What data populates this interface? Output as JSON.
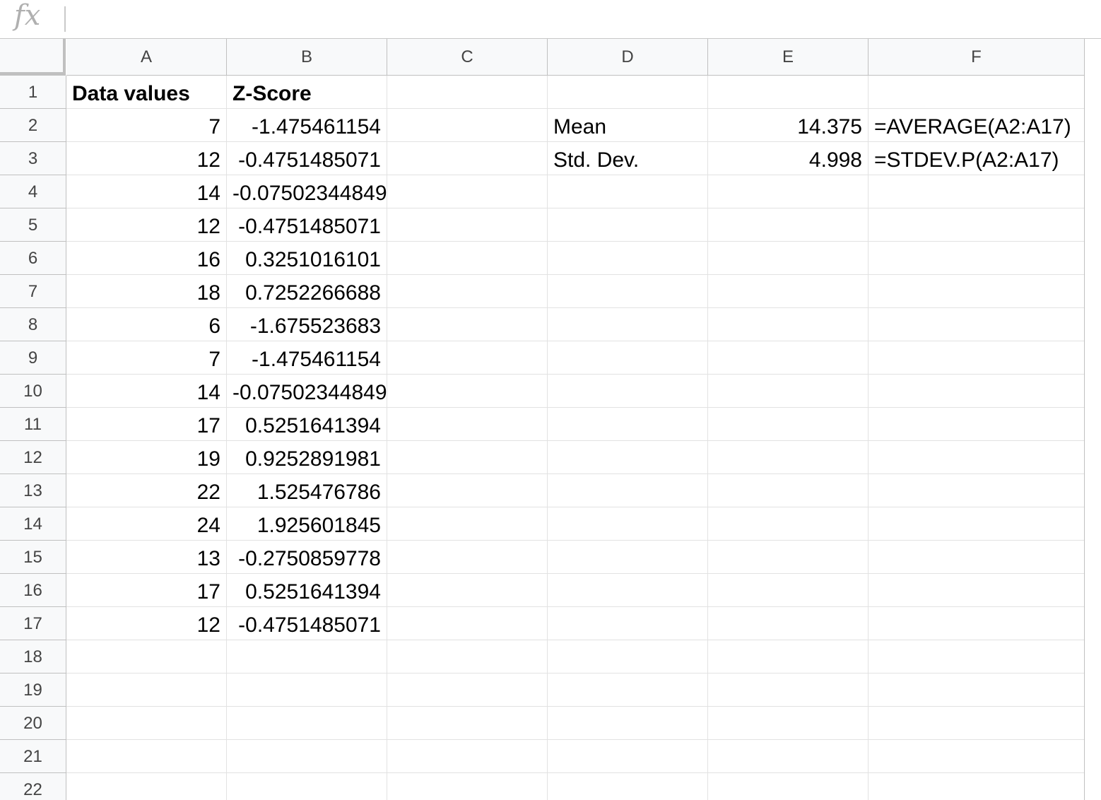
{
  "formula_bar": {
    "icon": "fx-icon",
    "value": ""
  },
  "columns": [
    "A",
    "B",
    "C",
    "D",
    "E",
    "F"
  ],
  "rows": [
    {
      "num": "1",
      "cells": [
        "Data values",
        "Z-Score",
        "",
        "",
        "",
        ""
      ]
    },
    {
      "num": "2",
      "cells": [
        "7",
        "-1.475461154",
        "",
        "Mean",
        "14.375",
        "=AVERAGE(A2:A17)"
      ]
    },
    {
      "num": "3",
      "cells": [
        "12",
        "-0.4751485071",
        "",
        "Std. Dev.",
        "4.998",
        "=STDEV.P(A2:A17)"
      ]
    },
    {
      "num": "4",
      "cells": [
        "14",
        "-0.07502344849",
        "",
        "",
        "",
        ""
      ]
    },
    {
      "num": "5",
      "cells": [
        "12",
        "-0.4751485071",
        "",
        "",
        "",
        ""
      ]
    },
    {
      "num": "6",
      "cells": [
        "16",
        "0.3251016101",
        "",
        "",
        "",
        ""
      ]
    },
    {
      "num": "7",
      "cells": [
        "18",
        "0.7252266688",
        "",
        "",
        "",
        ""
      ]
    },
    {
      "num": "8",
      "cells": [
        "6",
        "-1.675523683",
        "",
        "",
        "",
        ""
      ]
    },
    {
      "num": "9",
      "cells": [
        "7",
        "-1.475461154",
        "",
        "",
        "",
        ""
      ]
    },
    {
      "num": "10",
      "cells": [
        "14",
        "-0.07502344849",
        "",
        "",
        "",
        ""
      ]
    },
    {
      "num": "11",
      "cells": [
        "17",
        "0.5251641394",
        "",
        "",
        "",
        ""
      ]
    },
    {
      "num": "12",
      "cells": [
        "19",
        "0.9252891981",
        "",
        "",
        "",
        ""
      ]
    },
    {
      "num": "13",
      "cells": [
        "22",
        "1.525476786",
        "",
        "",
        "",
        ""
      ]
    },
    {
      "num": "14",
      "cells": [
        "24",
        "1.925601845",
        "",
        "",
        "",
        ""
      ]
    },
    {
      "num": "15",
      "cells": [
        "13",
        "-0.2750859778",
        "",
        "",
        "",
        ""
      ]
    },
    {
      "num": "16",
      "cells": [
        "17",
        "0.5251641394",
        "",
        "",
        "",
        ""
      ]
    },
    {
      "num": "17",
      "cells": [
        "12",
        "-0.4751485071",
        "",
        "",
        "",
        ""
      ]
    },
    {
      "num": "18",
      "cells": [
        "",
        "",
        "",
        "",
        "",
        ""
      ]
    },
    {
      "num": "19",
      "cells": [
        "",
        "",
        "",
        "",
        "",
        ""
      ]
    },
    {
      "num": "20",
      "cells": [
        "",
        "",
        "",
        "",
        "",
        ""
      ]
    },
    {
      "num": "21",
      "cells": [
        "",
        "",
        "",
        "",
        "",
        ""
      ]
    },
    {
      "num": "22",
      "cells": [
        "",
        "",
        "",
        "",
        "",
        ""
      ]
    }
  ]
}
